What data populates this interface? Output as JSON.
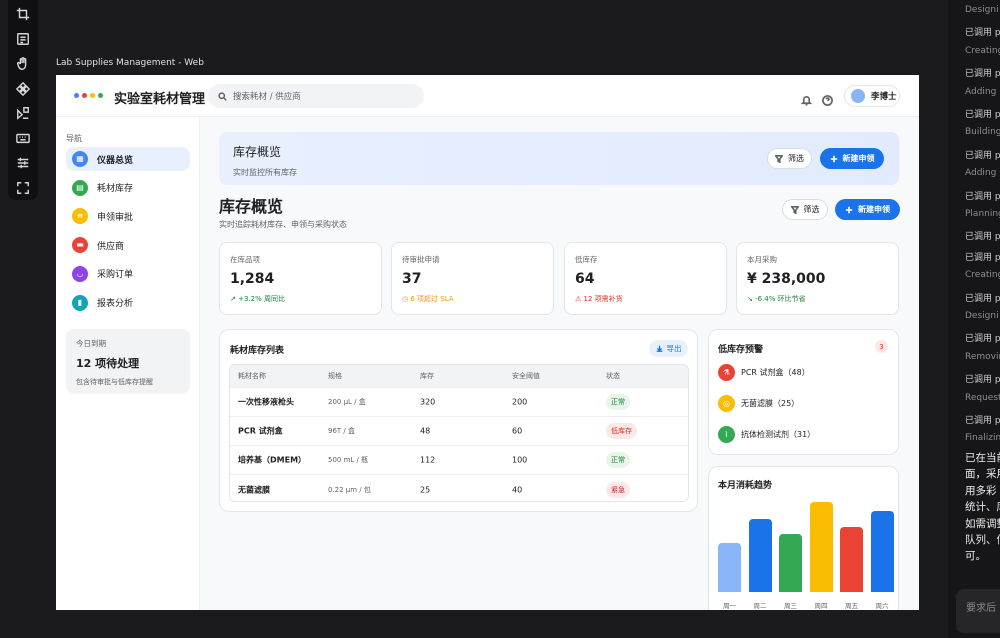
{
  "window_title": "Lab Supplies Management - Web",
  "header": {
    "app_title": "实验室耗材管理",
    "search_placeholder": "搜索耗材 / 供应商",
    "user_name": "李博士"
  },
  "sidebar": {
    "heading": "导航",
    "items": [
      {
        "label": "仪器总览",
        "icon": "grid-icon",
        "color": "#4285f4",
        "active": true
      },
      {
        "label": "耗材库存",
        "icon": "box-icon",
        "color": "#34a853"
      },
      {
        "label": "申领审批",
        "icon": "clipboard-icon",
        "color": "#fbbc04"
      },
      {
        "label": "供应商",
        "icon": "truck-icon",
        "color": "#ea4335"
      },
      {
        "label": "采购订单",
        "icon": "cart-icon",
        "color": "#8e44ec"
      },
      {
        "label": "报表分析",
        "icon": "chart-icon",
        "color": "#12a4b8"
      }
    ],
    "due": {
      "label": "今日到期",
      "value": "12 项待处理",
      "note": "包含待审批与低库存提醒"
    }
  },
  "banner": {
    "title": "库存概览",
    "subtitle": "实时监控所有库存",
    "filter_label": "筛选",
    "new_label": "新建申领"
  },
  "page": {
    "title": "库存概览",
    "subtitle": "实时追踪耗材库存、申领与采购状态",
    "filter_label": "筛选",
    "new_label": "新建申领"
  },
  "kpis": [
    {
      "label": "在库品项",
      "value": "1,284",
      "delta": "+3.2% 周同比",
      "color": "#188038"
    },
    {
      "label": "待审批申请",
      "value": "37",
      "delta": "6 项超过 SLA",
      "color": "#f29900"
    },
    {
      "label": "低库存",
      "value": "64",
      "delta": "12 项需补货",
      "color": "#d93025"
    },
    {
      "label": "本月采购",
      "value": "¥ 238,000",
      "delta": "-6.4% 环比节省",
      "color": "#188038"
    }
  ],
  "inventory": {
    "title": "耗材库存列表",
    "export_label": "导出",
    "columns": [
      "耗材名称",
      "规格",
      "库存",
      "安全阈值",
      "状态"
    ],
    "rows": [
      {
        "name": "一次性移液枪头",
        "spec": "200 µL / 盒",
        "stock": "320",
        "threshold": "200",
        "status": "正常",
        "status_type": "ok"
      },
      {
        "name": "PCR 试剂盒",
        "spec": "96T / 盒",
        "stock": "48",
        "threshold": "60",
        "status": "低库存",
        "status_type": "low"
      },
      {
        "name": "培养基（DMEM）",
        "spec": "500 mL / 瓶",
        "stock": "112",
        "threshold": "100",
        "status": "正常",
        "status_type": "ok"
      },
      {
        "name": "无菌滤膜",
        "spec": "0.22 µm / 包",
        "stock": "25",
        "threshold": "40",
        "status": "紧急",
        "status_type": "urg"
      }
    ]
  },
  "alerts": {
    "title": "低库存预警",
    "count": "3",
    "items": [
      {
        "label": "PCR 试剂盒（48）",
        "color": "#ea4335",
        "icon": "flask-icon"
      },
      {
        "label": "无菌滤膜（25）",
        "color": "#fbbc04",
        "icon": "filter-icon"
      },
      {
        "label": "抗体检测试剂（31）",
        "color": "#34a853",
        "icon": "tube-icon"
      }
    ]
  },
  "chart_data": {
    "type": "bar",
    "title": "本月消耗趋势",
    "categories": [
      "周一",
      "周二",
      "周三",
      "周四",
      "周五",
      "周六"
    ],
    "values": [
      36,
      54,
      43,
      66,
      48,
      60
    ],
    "colors": [
      "#8ab4f8",
      "#1a73e8",
      "#34a853",
      "#fbbc04",
      "#ea4335",
      "#1a73e8"
    ],
    "ylim": [
      0,
      70
    ]
  },
  "right_panel": {
    "log": [
      "Designi",
      "已调用 p",
      "Creating",
      "已调用 p",
      "Adding",
      "已调用 p",
      "Building",
      "已调用 p",
      "Adding",
      "已调用 p",
      "Planning",
      "已调用 p",
      "已调用 p",
      "Creating",
      "已调用 p",
      "Designi",
      "已调用 p",
      "Removin",
      "已调用 p",
      "Request",
      "已调用 p",
      "Finalizin"
    ],
    "message": [
      "已在当前",
      "面，采用",
      "用多彩",
      "统计、库",
      "如需调整",
      "队列、信",
      "可。"
    ],
    "input_placeholder": "要求后"
  }
}
